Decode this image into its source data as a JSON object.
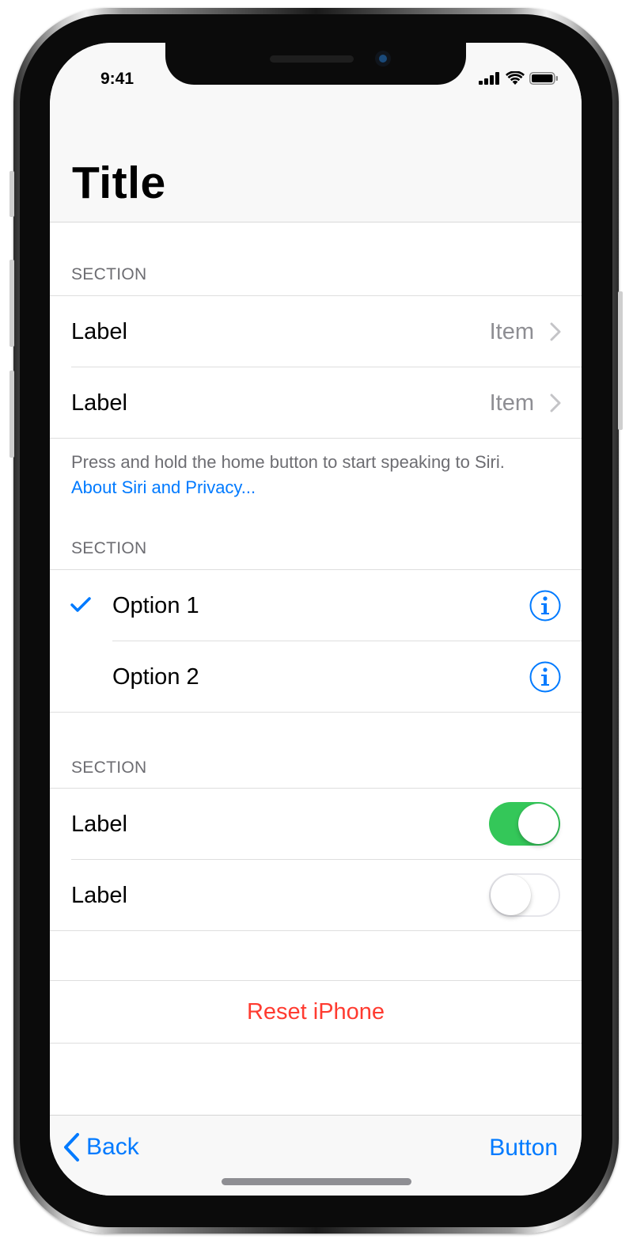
{
  "status_bar": {
    "time": "9:41",
    "icons": [
      "cellular-signal-icon",
      "wifi-icon",
      "battery-icon"
    ]
  },
  "nav": {
    "title": "Title"
  },
  "sections": [
    {
      "header": "SECTION",
      "rows": [
        {
          "label": "Label",
          "detail": "Item",
          "accessory": "chevron-right-icon"
        },
        {
          "label": "Label",
          "detail": "Item",
          "accessory": "chevron-right-icon"
        }
      ],
      "footer": {
        "text": "Press and hold the home button to start speaking to Siri.",
        "link": "About Siri and Privacy..."
      }
    },
    {
      "header": "SECTION",
      "rows": [
        {
          "label": "Option 1",
          "checked": true,
          "accessory": "info-icon"
        },
        {
          "label": "Option 2",
          "checked": false,
          "accessory": "info-icon"
        }
      ]
    },
    {
      "header": "SECTION",
      "rows": [
        {
          "label": "Label",
          "toggle": true
        },
        {
          "label": "Label",
          "toggle": false
        }
      ]
    }
  ],
  "destructive_action": {
    "label": "Reset iPhone"
  },
  "toolbar": {
    "back_label": "Back",
    "right_button_label": "Button"
  },
  "colors": {
    "tint": "#007aff",
    "destructive": "#ff3b30",
    "toggle_on": "#34c759",
    "secondary_text": "#8e8e93",
    "section_header": "#6d6d72"
  }
}
